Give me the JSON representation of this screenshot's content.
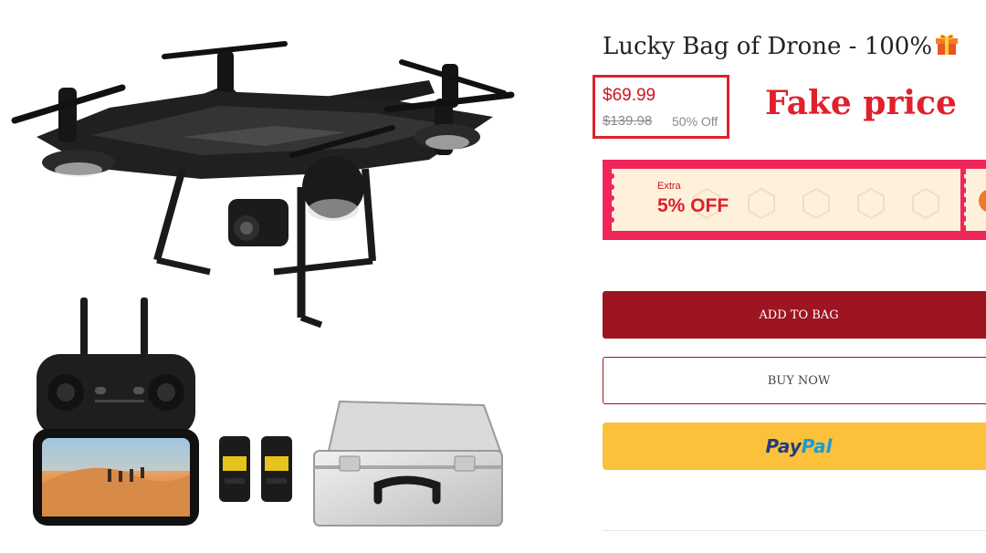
{
  "product": {
    "title": "Lucky Bag of Drone - 100%",
    "price_current": "$69.99",
    "price_original": "$139.98",
    "discount_label": "50% Off"
  },
  "annotation": {
    "text": "Fake price",
    "color": "#e0202a"
  },
  "coupon": {
    "label": "Extra",
    "value": "5% OFF"
  },
  "actions": {
    "add_to_bag": "ADD TO BAG",
    "buy_now": "BUY NOW"
  },
  "paypal": {
    "part1": "Pay",
    "part2": "Pal"
  },
  "colors": {
    "brand": "#9e1421",
    "price": "#d0141c",
    "coupon_bg": "#f0265a",
    "paypal": "#fbc13a"
  }
}
